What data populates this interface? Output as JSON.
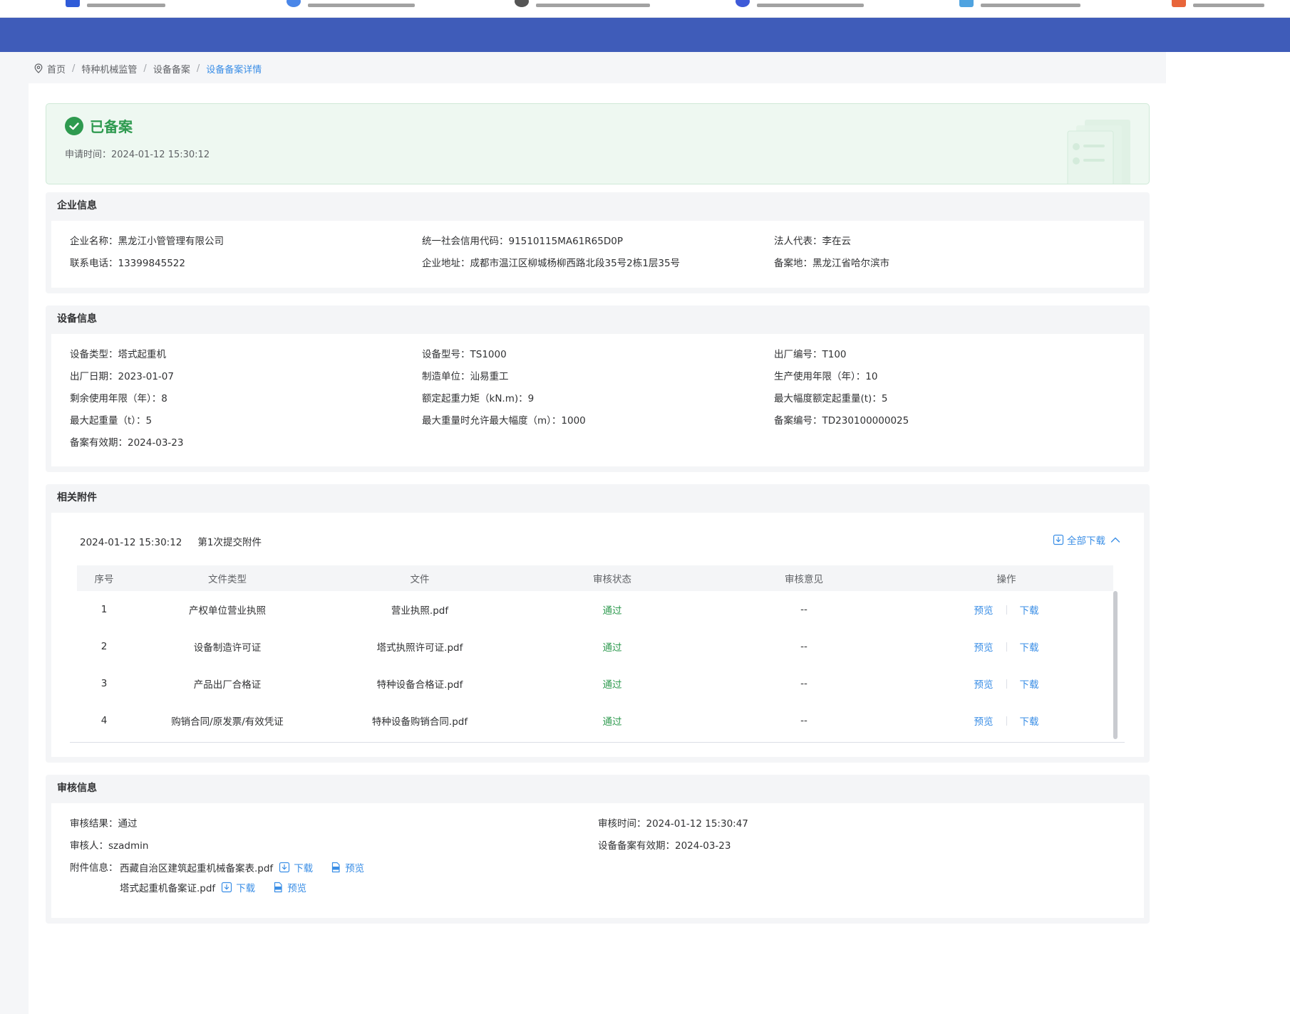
{
  "breadcrumb": {
    "home": "首页",
    "level1": "特种机械监管",
    "level2": "设备备案",
    "current": "设备备案详情",
    "separator": "/"
  },
  "status": {
    "title": "已备案",
    "apply_time_label": "申请时间：",
    "apply_time": "2024-01-12 15:30:12"
  },
  "enterprise": {
    "title": "企业信息",
    "fields": [
      {
        "label": "企业名称：",
        "value": "黑龙江小管管理有限公司"
      },
      {
        "label": "统一社会信用代码：",
        "value": "91510115MA61R65D0P"
      },
      {
        "label": "法人代表：",
        "value": "李在云"
      },
      {
        "label": "联系电话：",
        "value": "13399845522"
      },
      {
        "label": "企业地址：",
        "value": "成都市温江区柳城杨柳西路北段35号2栋1层35号"
      },
      {
        "label": "备案地：",
        "value": "黑龙江省哈尔滨市"
      }
    ]
  },
  "equipment": {
    "title": "设备信息",
    "fields": [
      {
        "label": "设备类型：",
        "value": "塔式起重机"
      },
      {
        "label": "设备型号：",
        "value": "TS1000"
      },
      {
        "label": "出厂编号：",
        "value": "T100"
      },
      {
        "label": "出厂日期：",
        "value": "2023-01-07"
      },
      {
        "label": "制造单位：",
        "value": "汕易重工"
      },
      {
        "label": "生产使用年限（年）：",
        "value": "10"
      },
      {
        "label": "剩余使用年限（年）：",
        "value": "8"
      },
      {
        "label": "额定起重力矩（kN.m)：",
        "value": "9"
      },
      {
        "label": "最大幅度额定起重量(t)：",
        "value": "5"
      },
      {
        "label": "最大起重量（t）：",
        "value": "5"
      },
      {
        "label": "最大重量时允许最大幅度（m）：",
        "value": "1000"
      },
      {
        "label": "备案编号：",
        "value": "TD230100000025"
      },
      {
        "label": "备案有效期：",
        "value": "2024-03-23"
      }
    ]
  },
  "attachments": {
    "title": "相关附件",
    "submit_time": "2024-01-12 15:30:12",
    "submit_label": "第1次提交附件",
    "download_all": "全部下载",
    "columns": [
      "序号",
      "文件类型",
      "文件",
      "审核状态",
      "审核意见",
      "操作"
    ],
    "rows": [
      {
        "no": "1",
        "type": "产权单位营业执照",
        "file": "营业执照.pdf",
        "status": "通过",
        "opinion": "--",
        "preview": "预览",
        "download": "下载"
      },
      {
        "no": "2",
        "type": "设备制造许可证",
        "file": "塔式执照许可证.pdf",
        "status": "通过",
        "opinion": "--",
        "preview": "预览",
        "download": "下载"
      },
      {
        "no": "3",
        "type": "产品出厂合格证",
        "file": "特种设备合格证.pdf",
        "status": "通过",
        "opinion": "--",
        "preview": "预览",
        "download": "下载"
      },
      {
        "no": "4",
        "type": "购销合同/原发票/有效凭证",
        "file": "特种设备购销合同.pdf",
        "status": "通过",
        "opinion": "--",
        "preview": "预览",
        "download": "下载"
      }
    ]
  },
  "audit": {
    "title": "审核信息",
    "result_label": "审核结果：",
    "result": "通过",
    "time_label": "审核时间：",
    "time": "2024-01-12 15:30:47",
    "auditor_label": "审核人：",
    "auditor": "szadmin",
    "valid_label": "设备备案有效期：",
    "valid": "2024-03-23",
    "files_label": "附件信息：",
    "files": [
      {
        "name": "西藏自治区建筑起重机械备案表.pdf",
        "download": "下载",
        "preview": "预览"
      },
      {
        "name": "塔式起重机备案证.pdf",
        "download": "下载",
        "preview": "预览"
      }
    ]
  },
  "colors": {
    "header": "#3f5cb9",
    "accent": "#3a8ee6",
    "success": "#2e9a4f",
    "status_bg": "#eef8f1",
    "section_bg": "#f4f5f7"
  },
  "icons": {
    "breadcrumb": "location-pin-icon",
    "status": "check-circle-icon",
    "download": "download-icon",
    "preview": "file-icon",
    "collapse": "chevron-up-icon"
  }
}
